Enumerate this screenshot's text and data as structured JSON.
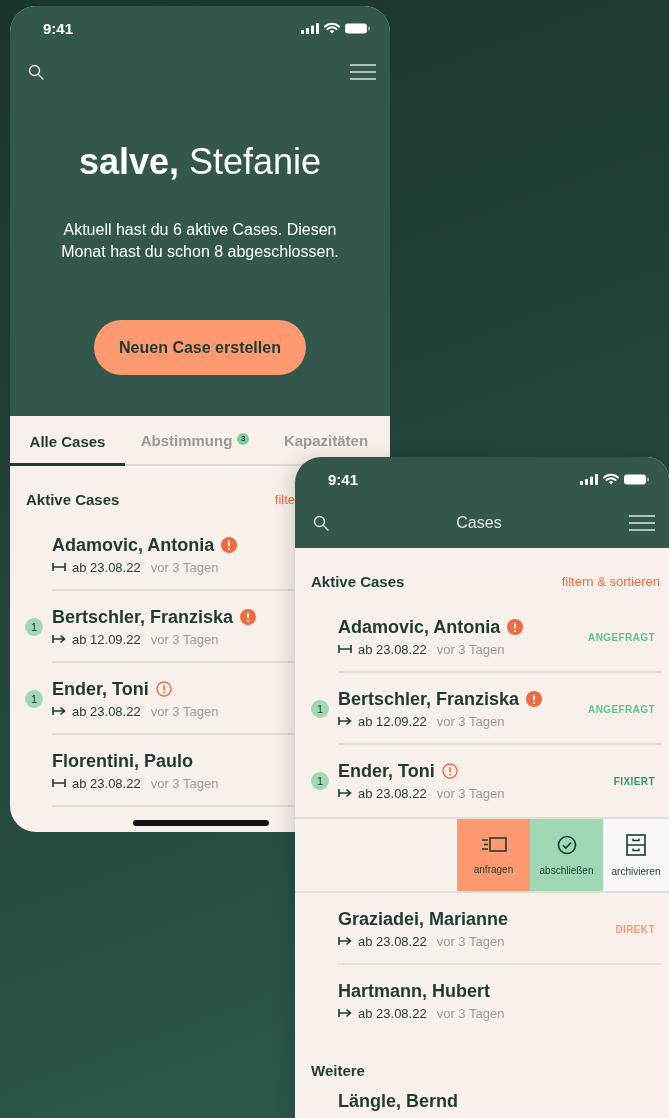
{
  "home_screen": {
    "status_bar": {
      "time": "9:41"
    },
    "greeting": "**salve,** Stefanie",
    "message": "Aktuell hast du 6 aktive Cases. Diesen Monat hast du schon 8 abgeschlossen.",
    "create_button": "Neuen Case erstellen",
    "tabs": [
      {
        "label": "Alle Cases",
        "selected": true
      },
      {
        "label": "Abstimmung",
        "selected": false,
        "badge": "3"
      },
      {
        "label": "Kapazitäten",
        "selected": false
      }
    ],
    "section_title": "Aktive Cases",
    "filter_link": "filte",
    "cases": [
      {
        "name": "Adamovic, Antonia",
        "alert": true,
        "alert_filled": true,
        "open_range": true,
        "date": "ab 23.08.22",
        "ago": "vor 3 Tagen"
      },
      {
        "name": "Bertschler, Franziska",
        "badge": "1",
        "alert": true,
        "alert_filled": true,
        "open_range": false,
        "date": "ab 12.09.22",
        "ago": "vor 3 Tagen"
      },
      {
        "name": "Ender, Toni",
        "badge": "1",
        "alert": true,
        "alert_filled": false,
        "open_range": false,
        "date": "ab 23.08.22",
        "ago": "vor 3 Tagen"
      },
      {
        "name": "Florentini, Paulo",
        "alert": false,
        "open_range": true,
        "date": "ab 23.08.22",
        "ago": "vor 3 Tagen"
      }
    ]
  },
  "cases_screen": {
    "status_bar": {
      "time": "9:41"
    },
    "title": "Cases",
    "sections": [
      {
        "title": "Aktive Cases",
        "link": "filtern & sortieren",
        "items": [
          {
            "kind": "case",
            "name": "Adamovic, Antonia",
            "alert": true,
            "alert_filled": true,
            "open_range": true,
            "date": "ab 23.08.22",
            "ago": "vor 3 Tagen",
            "status": "ANGEFRAGT",
            "color": "#5fc28a"
          },
          {
            "kind": "case",
            "name": "Bertschler, Franziska",
            "badge": "1",
            "alert": true,
            "alert_filled": true,
            "open_range": false,
            "date": "ab 12.09.22",
            "ago": "vor 3 Tagen",
            "status": "ANGEFRAGT",
            "color": "#5fc28a"
          },
          {
            "kind": "case",
            "name": "Ender, Toni",
            "badge": "1",
            "alert": true,
            "alert_filled": false,
            "open_range": false,
            "date": "ab 23.08.22",
            "ago": "vor 3 Tagen",
            "status": "FIXIERT",
            "color": "#2e9a6a"
          },
          {
            "kind": "swipe_actions",
            "actions": [
              {
                "kind": "request",
                "label": "anfragen"
              },
              {
                "kind": "complete",
                "label": "abschließen"
              },
              {
                "kind": "archive",
                "label": "archivieren"
              }
            ]
          },
          {
            "kind": "case",
            "name": "Graziadei, Marianne",
            "alert": false,
            "open_range": false,
            "date": "ab 23.08.22",
            "ago": "vor 3 Tagen",
            "status": "DIREKT",
            "color": "#f79a76"
          },
          {
            "kind": "case",
            "name": "Hartmann, Hubert",
            "alert": false,
            "open_range": false,
            "date": "ab 23.08.22",
            "ago": "vor 3 Tagen"
          }
        ]
      },
      {
        "title": "Weitere",
        "items": [
          {
            "kind": "case",
            "name": "Längle, Bernd",
            "alert": false
          }
        ]
      }
    ]
  }
}
